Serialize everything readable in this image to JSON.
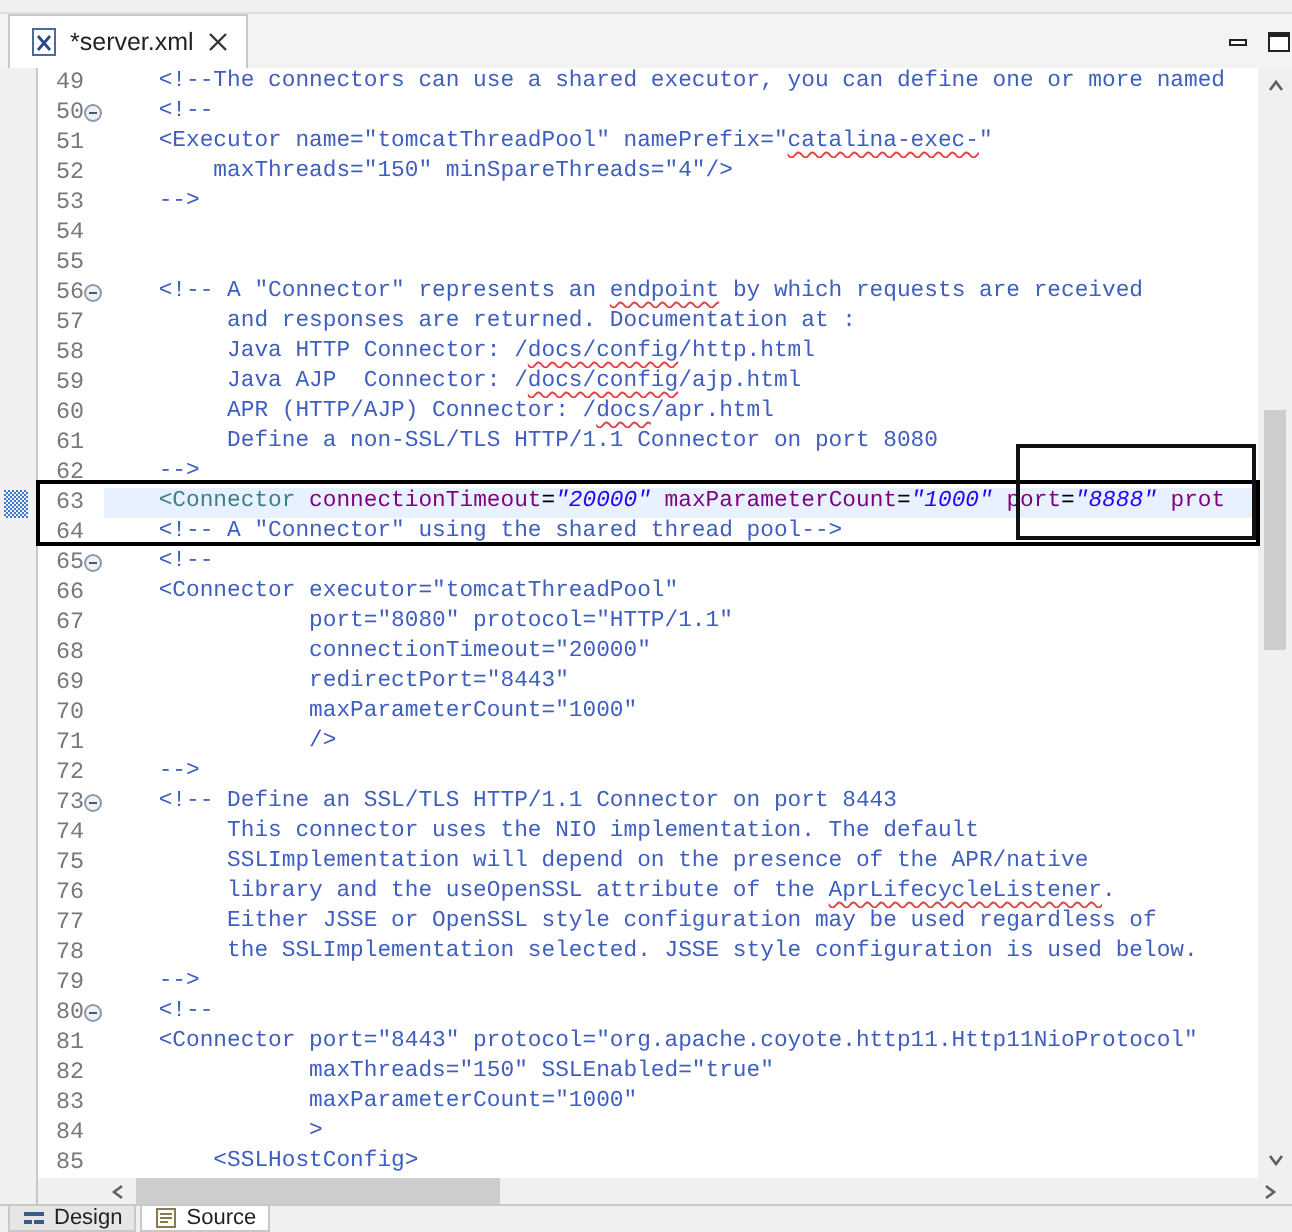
{
  "editor_tabs": [
    {
      "label": "*server.xml",
      "selected": true
    }
  ],
  "lines": [
    {
      "number": "49",
      "fold": false,
      "current": false,
      "segments": [
        {
          "kind": "comment",
          "text": "    <!--The connectors can use a shared executor, you can define one or more named"
        }
      ]
    },
    {
      "number": "50",
      "fold": true,
      "current": false,
      "segments": [
        {
          "kind": "comment",
          "text": "    <!--"
        }
      ]
    },
    {
      "number": "51",
      "fold": false,
      "current": false,
      "segments": [
        {
          "kind": "comment",
          "text": "    <Executor name=\"tomcatThreadPool\" namePrefix=\""
        },
        {
          "kind": "misspelled",
          "text": "catalina-exec-"
        },
        {
          "kind": "comment",
          "text": "\""
        }
      ]
    },
    {
      "number": "52",
      "fold": false,
      "current": false,
      "segments": [
        {
          "kind": "comment",
          "text": "        maxThreads=\"150\" minSpareThreads=\"4\"/>"
        }
      ]
    },
    {
      "number": "53",
      "fold": false,
      "current": false,
      "segments": [
        {
          "kind": "comment",
          "text": "    -->"
        }
      ]
    },
    {
      "number": "54",
      "fold": false,
      "current": false
    },
    {
      "number": "55",
      "fold": false,
      "current": false
    },
    {
      "number": "56",
      "fold": true,
      "current": false,
      "segments": [
        {
          "kind": "comment",
          "text": "    <!-- A \"Connector\" represents an "
        },
        {
          "kind": "misspelled",
          "text": "endpoint"
        },
        {
          "kind": "comment",
          "text": " by which requests are received"
        }
      ]
    },
    {
      "number": "57",
      "fold": false,
      "current": false,
      "segments": [
        {
          "kind": "comment",
          "text": "         and responses are returned. Documentation at :"
        }
      ]
    },
    {
      "number": "58",
      "fold": false,
      "current": false,
      "segments": [
        {
          "kind": "comment",
          "text": "         Java HTTP Connector: /"
        },
        {
          "kind": "misspelled",
          "text": "docs/config"
        },
        {
          "kind": "comment",
          "text": "/http.html"
        }
      ]
    },
    {
      "number": "59",
      "fold": false,
      "current": false,
      "segments": [
        {
          "kind": "comment",
          "text": "         Java AJP  Connector: /"
        },
        {
          "kind": "misspelled",
          "text": "docs/config"
        },
        {
          "kind": "comment",
          "text": "/ajp.html"
        }
      ]
    },
    {
      "number": "60",
      "fold": false,
      "current": false,
      "segments": [
        {
          "kind": "comment",
          "text": "         APR (HTTP/AJP) Connector: /"
        },
        {
          "kind": "misspelled",
          "text": "docs"
        },
        {
          "kind": "comment",
          "text": "/apr.html"
        }
      ]
    },
    {
      "number": "61",
      "fold": false,
      "current": false,
      "segments": [
        {
          "kind": "comment",
          "text": "         Define a non-SSL/TLS HTTP/1.1 Connector on port 8080"
        }
      ]
    },
    {
      "number": "62",
      "fold": false,
      "current": false,
      "segments": [
        {
          "kind": "comment",
          "text": "    -->"
        }
      ]
    },
    {
      "number": "63",
      "fold": false,
      "current": true,
      "segments": [
        {
          "kind": "tag",
          "text": "    <Connector"
        },
        {
          "kind": "attribute",
          "text": " connectionTimeout"
        },
        {
          "kind": "plain",
          "text": "="
        },
        {
          "kind": "value",
          "text": "\"20000\""
        },
        {
          "kind": "attribute",
          "text": " maxParameterCount"
        },
        {
          "kind": "plain",
          "text": "="
        },
        {
          "kind": "value",
          "text": "\"1000\""
        },
        {
          "kind": "attribute",
          "text": " port"
        },
        {
          "kind": "plain",
          "text": "="
        },
        {
          "kind": "value",
          "text": "\"8888\""
        },
        {
          "kind": "attribute",
          "text": " prot"
        }
      ]
    },
    {
      "number": "64",
      "fold": false,
      "current": false,
      "segments": [
        {
          "kind": "comment",
          "text": "    <!-- A \"Connector\" using the shared thread pool-->"
        }
      ]
    },
    {
      "number": "65",
      "fold": true,
      "current": false,
      "segments": [
        {
          "kind": "comment",
          "text": "    <!--"
        }
      ]
    },
    {
      "number": "66",
      "fold": false,
      "current": false,
      "segments": [
        {
          "kind": "comment",
          "text": "    <Connector executor=\"tomcatThreadPool\""
        }
      ]
    },
    {
      "number": "67",
      "fold": false,
      "current": false,
      "segments": [
        {
          "kind": "comment",
          "text": "               port=\"8080\" protocol=\"HTTP/1.1\""
        }
      ]
    },
    {
      "number": "68",
      "fold": false,
      "current": false,
      "segments": [
        {
          "kind": "comment",
          "text": "               connectionTimeout=\"20000\""
        }
      ]
    },
    {
      "number": "69",
      "fold": false,
      "current": false,
      "segments": [
        {
          "kind": "comment",
          "text": "               redirectPort=\"8443\""
        }
      ]
    },
    {
      "number": "70",
      "fold": false,
      "current": false,
      "segments": [
        {
          "kind": "comment",
          "text": "               maxParameterCount=\"1000\""
        }
      ]
    },
    {
      "number": "71",
      "fold": false,
      "current": false,
      "segments": [
        {
          "kind": "comment",
          "text": "               />"
        }
      ]
    },
    {
      "number": "72",
      "fold": false,
      "current": false,
      "segments": [
        {
          "kind": "comment",
          "text": "    -->"
        }
      ]
    },
    {
      "number": "73",
      "fold": true,
      "current": false,
      "segments": [
        {
          "kind": "comment",
          "text": "    <!-- Define an SSL/TLS HTTP/1.1 Connector on port 8443"
        }
      ]
    },
    {
      "number": "74",
      "fold": false,
      "current": false,
      "segments": [
        {
          "kind": "comment",
          "text": "         This connector uses the NIO implementation. The default"
        }
      ]
    },
    {
      "number": "75",
      "fold": false,
      "current": false,
      "segments": [
        {
          "kind": "comment",
          "text": "         SSLImplementation will depend on the presence of the APR/native"
        }
      ]
    },
    {
      "number": "76",
      "fold": false,
      "current": false,
      "segments": [
        {
          "kind": "comment",
          "text": "         library and the useOpenSSL attribute of the "
        },
        {
          "kind": "misspelled",
          "text": "AprLifecycleListener"
        },
        {
          "kind": "comment",
          "text": "."
        }
      ]
    },
    {
      "number": "77",
      "fold": false,
      "current": false,
      "segments": [
        {
          "kind": "comment",
          "text": "         Either JSSE or OpenSSL style configuration may be used regardless of"
        }
      ]
    },
    {
      "number": "78",
      "fold": false,
      "current": false,
      "segments": [
        {
          "kind": "comment",
          "text": "         the SSLImplementation selected. JSSE style configuration is used below."
        }
      ]
    },
    {
      "number": "79",
      "fold": false,
      "current": false,
      "segments": [
        {
          "kind": "comment",
          "text": "    -->"
        }
      ]
    },
    {
      "number": "80",
      "fold": true,
      "current": false,
      "segments": [
        {
          "kind": "comment",
          "text": "    <!--"
        }
      ]
    },
    {
      "number": "81",
      "fold": false,
      "current": false,
      "segments": [
        {
          "kind": "comment",
          "text": "    <Connector port=\"8443\" protocol=\"org.apache.coyote.http11.Http11NioProtocol\""
        }
      ]
    },
    {
      "number": "82",
      "fold": false,
      "current": false,
      "segments": [
        {
          "kind": "comment",
          "text": "               maxThreads=\"150\" SSLEnabled=\"true\""
        }
      ]
    },
    {
      "number": "83",
      "fold": false,
      "current": false,
      "segments": [
        {
          "kind": "comment",
          "text": "               maxParameterCount=\"1000\""
        }
      ]
    },
    {
      "number": "84",
      "fold": false,
      "current": false,
      "segments": [
        {
          "kind": "comment",
          "text": "               >"
        }
      ]
    },
    {
      "number": "85",
      "fold": false,
      "current": false,
      "segments": [
        {
          "kind": "comment",
          "text": "        <SSLHostConfig>"
        }
      ]
    }
  ],
  "annotation_boxes": [
    {
      "kind": "line-frame"
    },
    {
      "kind": "value-frame"
    }
  ],
  "bottom_tabs": [
    {
      "label": "Design",
      "selected": false
    },
    {
      "label": "Source",
      "selected": true
    }
  ]
}
